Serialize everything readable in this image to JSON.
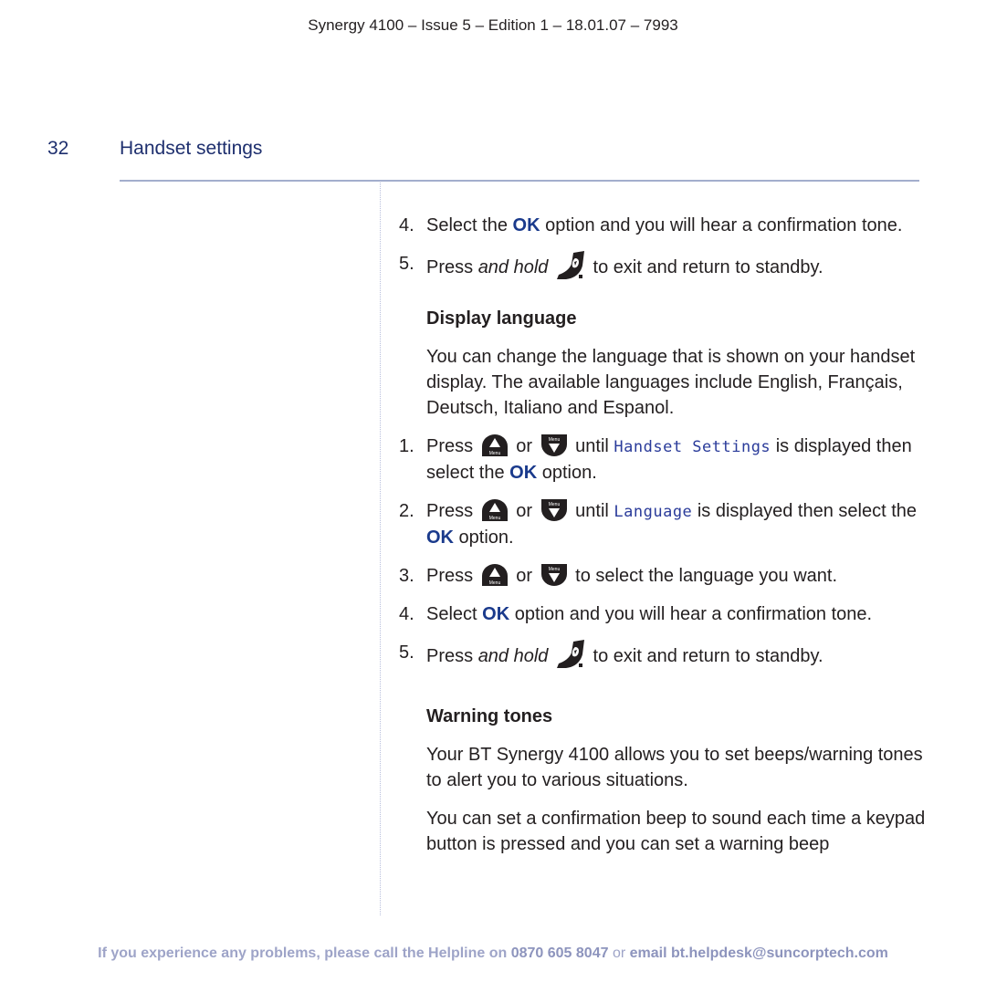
{
  "header": {
    "doc_info": "Synergy 4100 – Issue 5 – Edition 1 – 18.01.07 – 7993"
  },
  "page": {
    "number": "32",
    "section_title": "Handset settings"
  },
  "intro_steps": [
    {
      "num": "4.",
      "pre": "Select the ",
      "ok": "OK",
      "post": " option and you will hear a confirmation tone."
    },
    {
      "num": "5.",
      "pre": "Press ",
      "italic": "and hold",
      "post": " to exit and return to standby.",
      "icon": "end-call-icon"
    }
  ],
  "display_language": {
    "heading": "Display language",
    "description": "You can change the language that is shown on your handset display. The available languages include English, Français, Deutsch, Italiano and Espanol.",
    "steps": [
      {
        "num": "1.",
        "pre": "Press ",
        "or": " or ",
        "until": " until ",
        "lcd": "Handset Settings",
        "post": " is displayed then select the ",
        "ok": "OK",
        "end": " option."
      },
      {
        "num": "2.",
        "pre": "Press ",
        "or": " or ",
        "until": " until ",
        "lcd": "Language",
        "post": " is displayed then select the ",
        "ok": "OK",
        "end": " option."
      },
      {
        "num": "3.",
        "pre": "Press ",
        "or": " or ",
        "post": " to select the language you want."
      },
      {
        "num": "4.",
        "pre": "Select ",
        "ok": "OK",
        "post": " option and you will hear a confirmation tone."
      },
      {
        "num": "5.",
        "pre": "Press ",
        "italic": "and hold",
        "post": " to exit and return to standby."
      }
    ]
  },
  "warning_tones": {
    "heading": "Warning tones",
    "paragraphs": [
      "Your BT Synergy 4100 allows you to set beeps/warning tones to alert you to various situations.",
      "You can set a confirmation beep to sound each time a keypad button is pressed and you can set a warning beep"
    ]
  },
  "icons": {
    "up_key": "menu-up-key-icon",
    "down_key": "menu-down-key-icon",
    "end_key": "end-call-icon",
    "key_label": "Menu"
  },
  "footer": {
    "prefix": "If you experience any problems, please call the Helpline on ",
    "phone": "0870 605 8047",
    "or": " or ",
    "email_label": "email ",
    "email": "bt.helpdesk@suncorptech.com"
  },
  "colors": {
    "title_blue": "#1e2f6e",
    "ok_blue": "#1a3a8c",
    "lcd_blue": "#2a3b9a",
    "rule": "#a3aecd",
    "footer": "#9ea4c8"
  }
}
